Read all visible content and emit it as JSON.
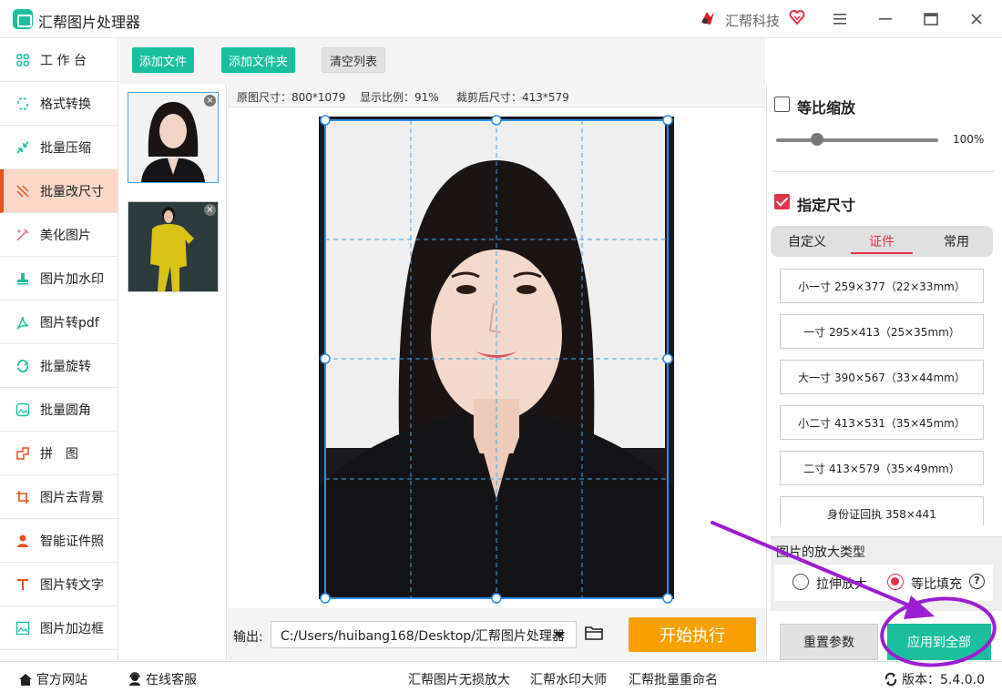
{
  "app": {
    "title": "汇帮图片处理器",
    "brand": "汇帮科技"
  },
  "sidebar": {
    "items": [
      {
        "label": "工 作 台",
        "icon": "grid-icon"
      },
      {
        "label": "格式转换",
        "icon": "convert-icon"
      },
      {
        "label": "批量压缩",
        "icon": "compress-icon"
      },
      {
        "label": "批量改尺寸",
        "icon": "resize-icon",
        "active": true
      },
      {
        "label": "美化图片",
        "icon": "beautify-icon"
      },
      {
        "label": "图片加水印",
        "icon": "watermark-icon"
      },
      {
        "label": "图片转pdf",
        "icon": "pdf-icon"
      },
      {
        "label": "批量旋转",
        "icon": "rotate-icon"
      },
      {
        "label": "批量圆角",
        "icon": "round-corner-icon"
      },
      {
        "label": "拼　图",
        "icon": "puzzle-icon"
      },
      {
        "label": "图片去背景",
        "icon": "crop-icon"
      },
      {
        "label": "智能证件照",
        "icon": "person-icon"
      },
      {
        "label": "图片转文字",
        "icon": "text-icon"
      },
      {
        "label": "图片加边框",
        "icon": "frame-icon"
      }
    ]
  },
  "toolbar": {
    "add_file": "添加文件",
    "add_folder": "添加文件夹",
    "clear_list": "清空列表"
  },
  "info": {
    "original_size": "原图尺寸：800*1079",
    "display_ratio": "显示比例：91%",
    "cropped_size": "裁剪后尺寸：413*579"
  },
  "output": {
    "label": "输出:",
    "path": "C:/Users/huibang168/Desktop/汇帮图片处理器",
    "start": "开始执行"
  },
  "right": {
    "proportional_label": "等比缩放",
    "proportional_checked": false,
    "zoom_value": "100%",
    "zoom_fraction": 0.22,
    "specify_label": "指定尺寸",
    "specify_checked": true,
    "tabs": [
      "自定义",
      "证件",
      "常用"
    ],
    "active_tab": 1,
    "sizes": [
      "小一寸 259×377（22×33mm）",
      "一寸 295×413（25×35mm）",
      "大一寸 390×567（33×44mm）",
      "小二寸 413×531（35×45mm）",
      "二寸 413×579（35×49mm）",
      "身份证回执 358×441"
    ],
    "enlarge_title": "图片的放大类型",
    "opt_stretch": "拉伸放大",
    "opt_fill": "等比填充",
    "help": "?",
    "reset": "重置参数",
    "apply_all": "应用到全部"
  },
  "footer": {
    "website": "官方网站",
    "service": "在线客服",
    "link1": "汇帮图片无损放大",
    "link2": "汇帮水印大师",
    "link3": "汇帮批量重命名",
    "version": "版本：5.4.0.0"
  },
  "colors": {
    "accent_green": "#1bbf9e",
    "accent_red": "#e0334c",
    "active_bg": "#fbd7c8",
    "start_orange": "#f8a000",
    "annotation_purple": "#9b1fd1"
  }
}
